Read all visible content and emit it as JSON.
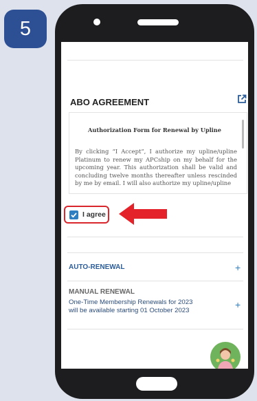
{
  "step": {
    "number": "5"
  },
  "abo_agreement": {
    "title": "ABO AGREEMENT",
    "form_title": "Authorization Form for Renewal by Upline",
    "body_text": "By clicking “I Accept”, I authorize my upline/upline Platinum to renew my APCship on my behalf for the upcoming year. This authorization shall be valid and concluding twelve months thereafter unless rescinded by me by email. I will also authorize my upline/upline",
    "agree_label": "I agree",
    "agree_checked": true
  },
  "auto_renewal": {
    "label": "AUTO-RENEWAL"
  },
  "manual_renewal": {
    "label": "MANUAL RENEWAL",
    "note_line1": "One-Time Membership Renewals for 2023",
    "note_line2": "will be available starting 01 October 2023"
  },
  "icons": [
    "external-link-icon",
    "checkmark-icon",
    "red-arrow-icon",
    "plus-icon",
    "chat-avatar-icon"
  ],
  "colors": {
    "badge": "#2d4f93",
    "highlight": "#d8262c",
    "link": "#2e7fc1",
    "chat": "#6fb35d"
  }
}
